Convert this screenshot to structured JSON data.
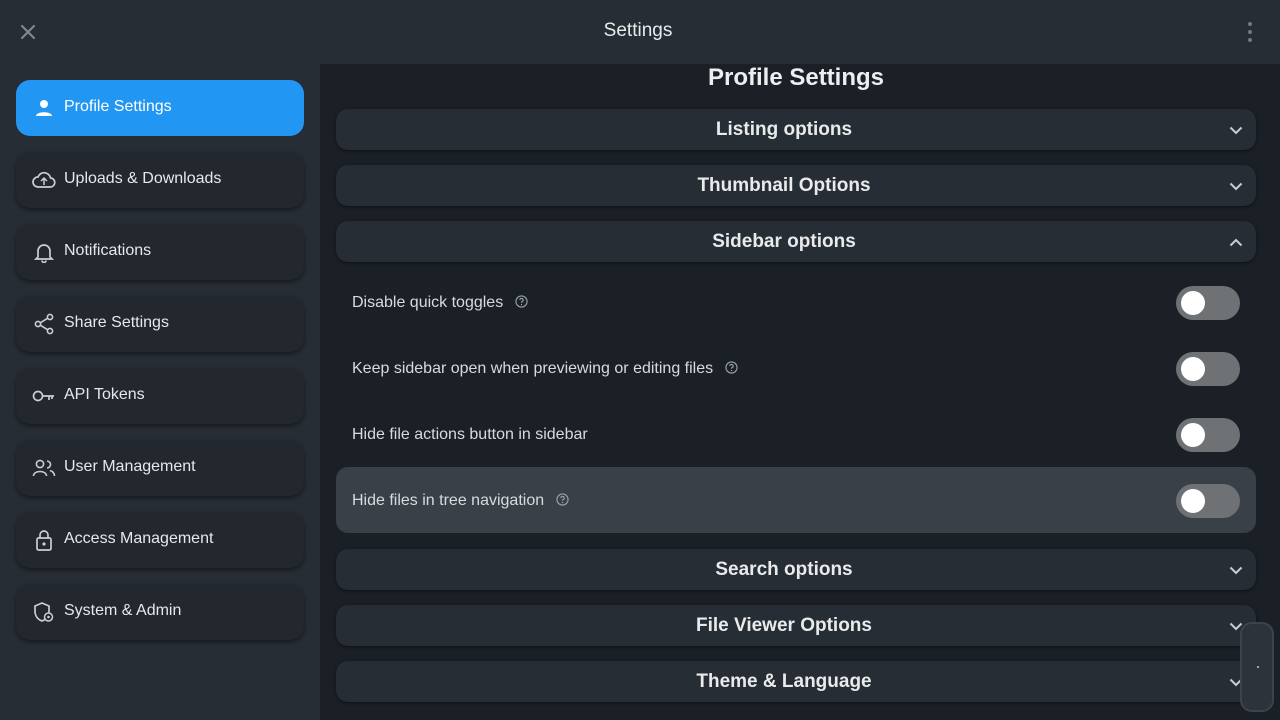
{
  "header": {
    "title": "Settings",
    "close_icon": "close-icon",
    "more_icon": "more-vertical-icon"
  },
  "sidebar": {
    "items": [
      {
        "label": "Profile Settings",
        "icon": "person-icon",
        "active": true
      },
      {
        "label": "Uploads & Downloads",
        "icon": "cloud-sync-icon",
        "active": false
      },
      {
        "label": "Notifications",
        "icon": "bell-icon",
        "active": false
      },
      {
        "label": "Share Settings",
        "icon": "share-icon",
        "active": false
      },
      {
        "label": "API Tokens",
        "icon": "key-icon",
        "active": false
      },
      {
        "label": "User Management",
        "icon": "users-icon",
        "active": false
      },
      {
        "label": "Access Management",
        "icon": "lock-icon",
        "active": false
      },
      {
        "label": "System & Admin",
        "icon": "shield-gear-icon",
        "active": false
      }
    ]
  },
  "main": {
    "page_title": "Profile Settings",
    "sections": [
      {
        "title": "Listing options",
        "expanded": false
      },
      {
        "title": "Thumbnail Options",
        "expanded": false
      },
      {
        "title": "Sidebar options",
        "expanded": true
      },
      {
        "title": "Search options",
        "expanded": false
      },
      {
        "title": "File Viewer Options",
        "expanded": false
      },
      {
        "title": "Theme & Language",
        "expanded": false
      }
    ],
    "sidebar_options": [
      {
        "label": "Disable quick toggles",
        "help": true,
        "value": false
      },
      {
        "label": "Keep sidebar open when previewing or editing files",
        "help": true,
        "value": false
      },
      {
        "label": "Hide file actions button in sidebar",
        "help": false,
        "value": false
      },
      {
        "label": "Hide files in tree navigation",
        "help": true,
        "value": false
      }
    ]
  },
  "colors": {
    "accent": "#2196f3",
    "background": "#1b2026",
    "surface": "#272d34"
  }
}
